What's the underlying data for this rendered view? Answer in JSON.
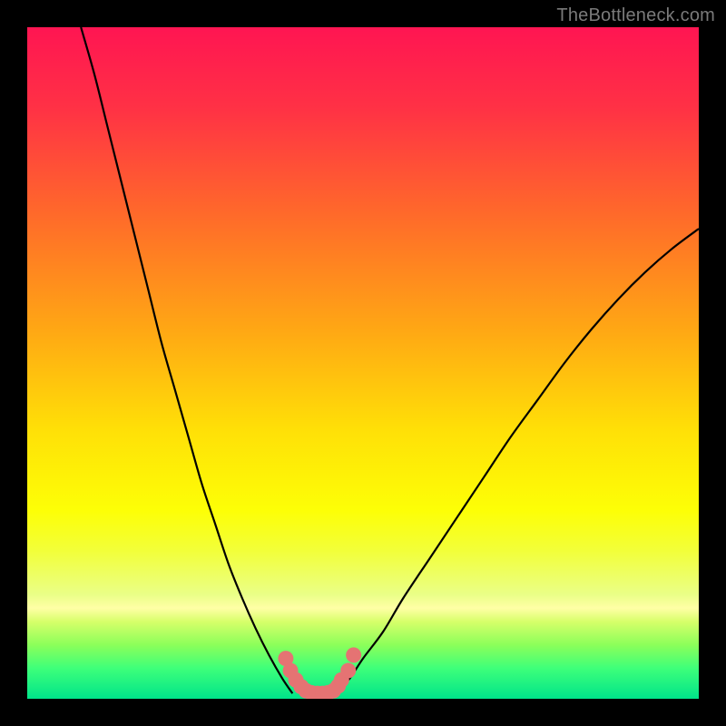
{
  "attribution": "TheBottleneck.com",
  "chart_data": {
    "type": "line",
    "title": "",
    "xlabel": "",
    "ylabel": "",
    "xlim": [
      0,
      100
    ],
    "ylim": [
      0,
      100
    ],
    "series": [
      {
        "name": "left-curve",
        "x": [
          8,
          10,
          12,
          14,
          16,
          18,
          20,
          22,
          24,
          26,
          28,
          30,
          32,
          34,
          36,
          38,
          39.5
        ],
        "y": [
          100,
          93,
          85,
          77,
          69,
          61,
          53,
          46,
          39,
          32,
          26,
          20,
          15,
          10.5,
          6.5,
          3,
          0.8
        ]
      },
      {
        "name": "right-curve",
        "x": [
          46,
          48,
          50,
          53,
          56,
          60,
          64,
          68,
          72,
          76,
          80,
          84,
          88,
          92,
          96,
          100
        ],
        "y": [
          1,
          3,
          6,
          10,
          15,
          21,
          27,
          33,
          39,
          44.5,
          50,
          55,
          59.5,
          63.5,
          67,
          70
        ]
      },
      {
        "name": "valley-marker",
        "style": "dots",
        "x": [
          38.5,
          39.2,
          40,
          40.8,
          41.5,
          42.3,
          43.2,
          44,
          44.8,
          45.6,
          46.3,
          46.8,
          47.8,
          48.6
        ],
        "y": [
          6,
          4.2,
          2.8,
          1.8,
          1.2,
          0.9,
          0.8,
          0.8,
          0.9,
          1.2,
          1.9,
          2.8,
          4.2,
          6.5
        ]
      }
    ],
    "background_gradient": {
      "stops": [
        {
          "offset": 0.0,
          "color": "#ff1552"
        },
        {
          "offset": 0.12,
          "color": "#ff3145"
        },
        {
          "offset": 0.28,
          "color": "#ff6a2a"
        },
        {
          "offset": 0.45,
          "color": "#ffa714"
        },
        {
          "offset": 0.6,
          "color": "#ffe007"
        },
        {
          "offset": 0.72,
          "color": "#fdff06"
        },
        {
          "offset": 0.78,
          "color": "#f2ff3a"
        },
        {
          "offset": 0.845,
          "color": "#eaff87"
        },
        {
          "offset": 0.865,
          "color": "#ffffa6"
        },
        {
          "offset": 0.885,
          "color": "#d7ff6a"
        },
        {
          "offset": 0.92,
          "color": "#8bff5a"
        },
        {
          "offset": 0.955,
          "color": "#3dff7a"
        },
        {
          "offset": 1.0,
          "color": "#00e48a"
        }
      ]
    },
    "marker_color": "#e57373",
    "line_color": "#000000"
  }
}
